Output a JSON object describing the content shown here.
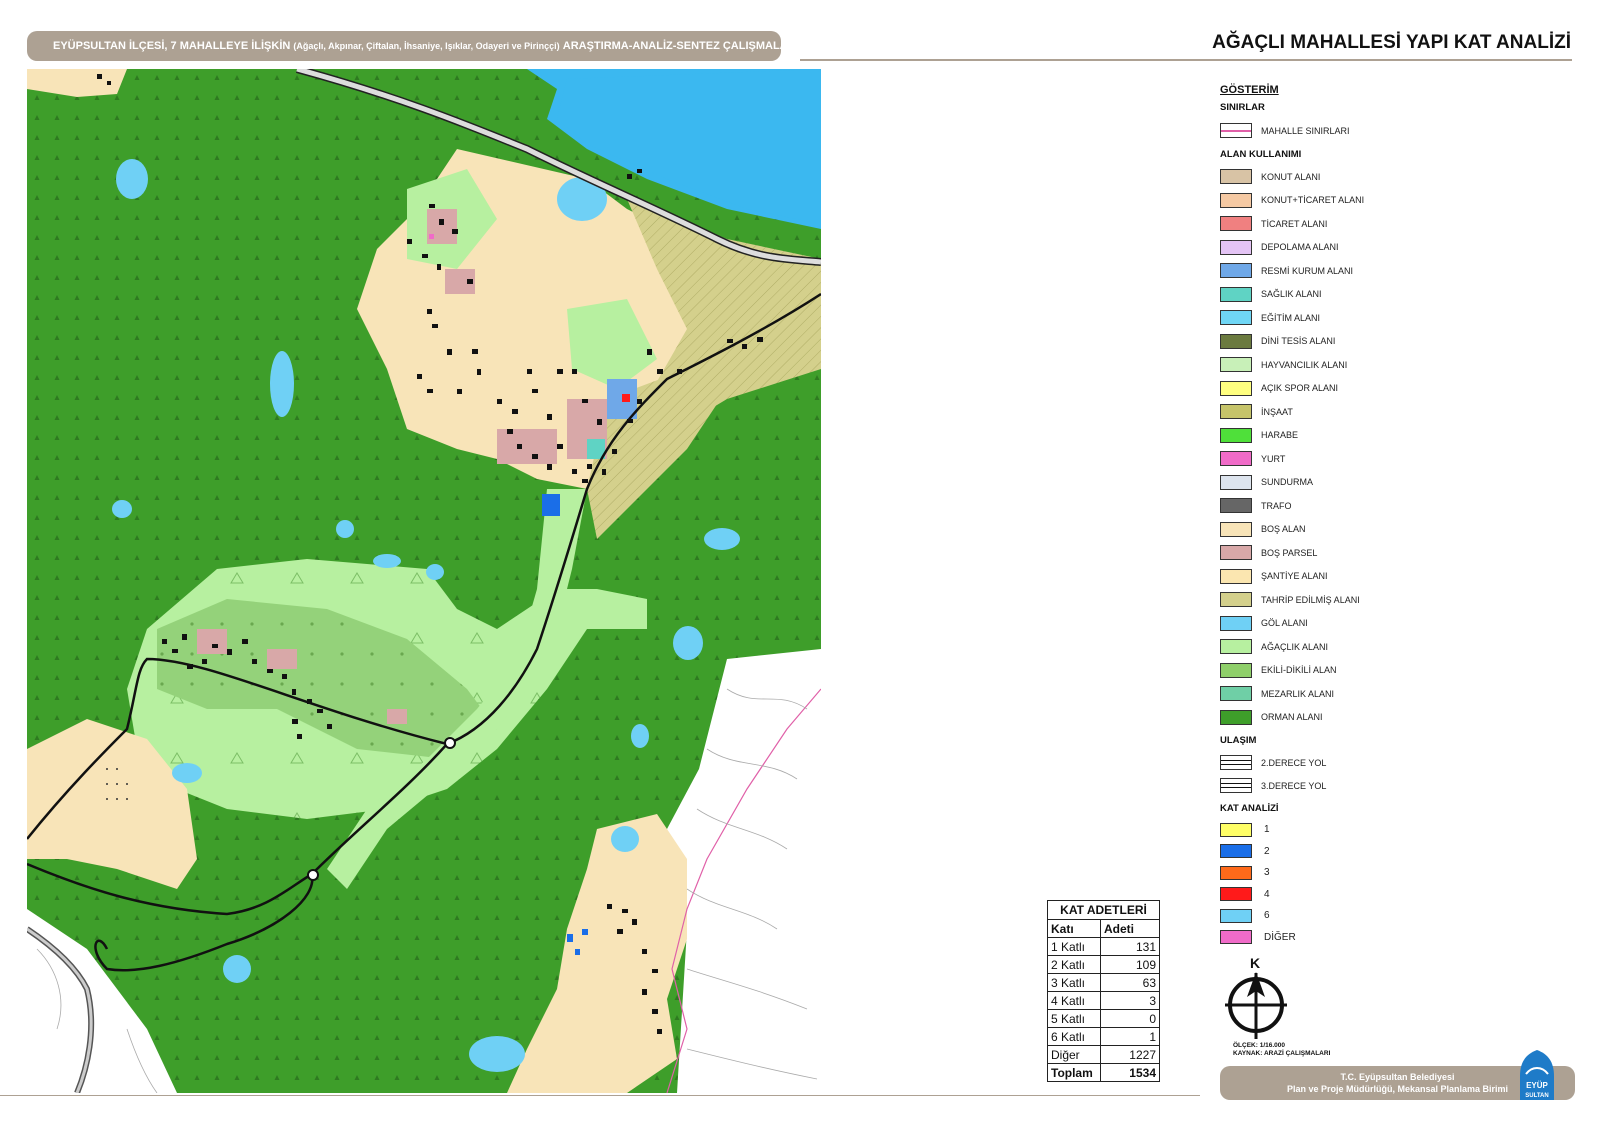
{
  "header": {
    "left_main": "EYÜPSULTAN İLÇESİ, 7 MAHALLEYE İLİŞKİN",
    "left_paren": "(Ağaçlı, Akpınar, Çiftalan, İhsaniye, Işıklar, Odayeri ve Pirinççi)",
    "left_tail": "ARAŞTIRMA-ANALİZ-SENTEZ ÇALIŞMALARI",
    "title": "AĞAÇLI MAHALLESİ YAPI KAT ANALİZİ"
  },
  "legend": {
    "title": "GÖSTERİM",
    "sections": {
      "sinirlar": "SINIRLAR",
      "alan": "ALAN KULLANIMI",
      "ulasim": "ULAŞIM",
      "kat": "KAT ANALİZİ"
    },
    "sinirlar_items": [
      {
        "label": "MAHALLE SINIRLARI",
        "color": "#ffffff",
        "icon": "pink-line"
      }
    ],
    "alan_items": [
      {
        "label": "KONUT ALANI",
        "color": "#d8c3a5"
      },
      {
        "label": "KONUT+TİCARET ALANI",
        "color": "#f5c9a3"
      },
      {
        "label": "TİCARET ALANI",
        "color": "#f08080"
      },
      {
        "label": "DEPOLAMA ALANI",
        "color": "#e4c4f5"
      },
      {
        "label": "RESMİ KURUM ALANI",
        "color": "#6fa8e8"
      },
      {
        "label": "SAĞLIK ALANI",
        "color": "#5fd3c4"
      },
      {
        "label": "EĞİTİM ALANI",
        "color": "#6fd6f5"
      },
      {
        "label": "DİNİ TESİS ALANI",
        "color": "#6b7a3f"
      },
      {
        "label": "HAYVANCILIK ALANI",
        "color": "#c8f0b8"
      },
      {
        "label": "AÇIK SPOR ALANI",
        "color": "#ffff80"
      },
      {
        "label": "İNŞAAT",
        "color": "#c6c46a"
      },
      {
        "label": "HARABE",
        "color": "#4fe03a"
      },
      {
        "label": "YURT",
        "color": "#f06bc8"
      },
      {
        "label": "SUNDURMA",
        "color": "#dde4ee"
      },
      {
        "label": "TRAFO",
        "color": "#666666"
      },
      {
        "label": "BOŞ ALAN",
        "color": "#f8e4b8"
      },
      {
        "label": "BOŞ PARSEL",
        "color": "#d8a8a8"
      },
      {
        "label": "ŞANTİYE ALANI",
        "color": "#fbe6b0"
      },
      {
        "label": "TAHRİP EDİLMİŞ ALANI",
        "color": "#d4d08c"
      },
      {
        "label": "GÖL ALANI",
        "color": "#6fd0f5"
      },
      {
        "label": "AĞAÇLIK ALANI",
        "color": "#b7f0a0"
      },
      {
        "label": "EKİLİ-DİKİLİ ALAN",
        "color": "#8fcf6a"
      },
      {
        "label": "MEZARLIK ALANI",
        "color": "#6fcfa6"
      },
      {
        "label": "ORMAN ALANI",
        "color": "#3e9e2a"
      }
    ],
    "ulasim_items": [
      {
        "label": "2.DERECE YOL",
        "color": "#ffffff"
      },
      {
        "label": "3.DERECE YOL",
        "color": "#ffffff"
      }
    ],
    "kat_items": [
      {
        "label": "1",
        "color": "#ffff66"
      },
      {
        "label": "2",
        "color": "#1a6ee8"
      },
      {
        "label": "3",
        "color": "#ff6a1a"
      },
      {
        "label": "4",
        "color": "#ff1a1a"
      },
      {
        "label": "6",
        "color": "#6fd0f5"
      },
      {
        "label": "DİĞER",
        "color": "#f06bc8"
      }
    ]
  },
  "compass": {
    "letter": "K"
  },
  "scale": {
    "olcek": "ÖLÇEK: 1/16.000",
    "kaynak": "KAYNAK: ARAZİ ÇALIŞMALARI"
  },
  "kat_table": {
    "title": "KAT ADETLERİ",
    "col1": "Katı",
    "col2": "Adeti",
    "rows": [
      {
        "label": "1 Katlı",
        "value": "131"
      },
      {
        "label": "2 Katlı",
        "value": "109"
      },
      {
        "label": "3 Katlı",
        "value": "63"
      },
      {
        "label": "4 Katlı",
        "value": "3"
      },
      {
        "label": "5 Katlı",
        "value": "0"
      },
      {
        "label": "6 Katlı",
        "value": "1"
      },
      {
        "label": "Diğer",
        "value": "1227"
      }
    ],
    "total_label": "Toplam",
    "total_value": "1534"
  },
  "footer": {
    "line1": "T.C. Eyüpsultan Belediyesi",
    "line2": "Plan ve Proje Müdürlüğü, Mekansal Planlama Birimi"
  },
  "logo": {
    "line1": "EYÜP",
    "line2": "SULTAN"
  },
  "colors": {
    "forest": "#3e9e2a",
    "tree_area": "#b7f0a0",
    "cultivated": "#8fcf6a",
    "empty": "#f8e4b8",
    "lake": "#6fd0f5",
    "sea": "#3bb8f0",
    "header": "#ada193"
  }
}
